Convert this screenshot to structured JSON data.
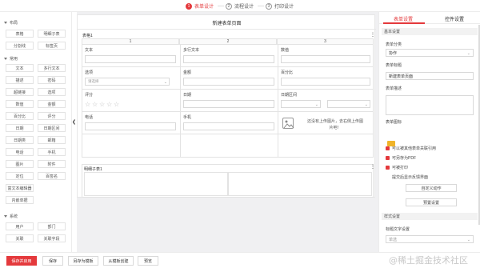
{
  "colors": {
    "accent": "#e4393c",
    "canvas_bg": "#f0f0f2",
    "border": "#e3e3e3"
  },
  "steps": [
    {
      "num": "1",
      "label": "表单设计",
      "active": true
    },
    {
      "num": "2",
      "label": "流程设计",
      "active": false
    },
    {
      "num": "3",
      "label": "打印设计",
      "active": false
    }
  ],
  "sidebar": {
    "layout_title": "布局",
    "layout_items": [
      "表格",
      "明细子表",
      "分割线",
      "标签页"
    ],
    "common_title": "常用",
    "common_items": [
      "文本",
      "多行文本",
      "描述",
      "密码",
      "超链接",
      "选项",
      "数值",
      "金额",
      "百分比",
      "评分",
      "日期",
      "日期区间",
      "日期类",
      "邮箱",
      "电话",
      "手机",
      "图片",
      "附件",
      "定位",
      "百签名",
      "富文本编辑器",
      "内嵌单据"
    ],
    "system_title": "系统",
    "system_items": [
      "用户",
      "部门",
      "关联",
      "关联字段"
    ],
    "collapse_icon": "chevron-left-icon"
  },
  "canvas": {
    "form_title": "新建表单页面",
    "table_label": "表格1",
    "columns": [
      "1",
      "2",
      "3"
    ],
    "fields": {
      "text": "文本",
      "multi_text": "多行文本",
      "number": "数值",
      "select": "选项",
      "select_placeholder": "请选择",
      "amount": "金额",
      "percent": "百分比",
      "rating": "评分",
      "date": "日期",
      "date_range": "日期区间",
      "phone": "电话",
      "mobile": "手机",
      "upload_text_1": "还没有上传图片，去右侧上传图",
      "upload_text_2": "片吧！"
    },
    "subtable_label": "明细子表1"
  },
  "right_panel": {
    "tabs": [
      "表单设置",
      "控件设置"
    ],
    "basic_section": "基本设置",
    "category_label": "表单分类",
    "category_value": "协作",
    "title_label": "表单标题",
    "title_value": "新建表单页面",
    "desc_label": "表单描述",
    "icon_label": "表单图标",
    "checks": [
      "可以被其他表单关联引用",
      "可另存为PDF",
      "可被打印",
      "提交后显示反馈界面"
    ],
    "custom_action_btn": "自定义动作",
    "preset_btn": "预置设置",
    "style_section": "样式设置",
    "title_text_label": "标题文字设置",
    "title_text_value": "单选"
  },
  "bottom": {
    "save_enable": "保存并启用",
    "save": "保存",
    "save_as_template": "另存为模板",
    "create_from_template": "从模板创建",
    "preview": "预览"
  },
  "watermark": "@稀土掘金技术社区"
}
